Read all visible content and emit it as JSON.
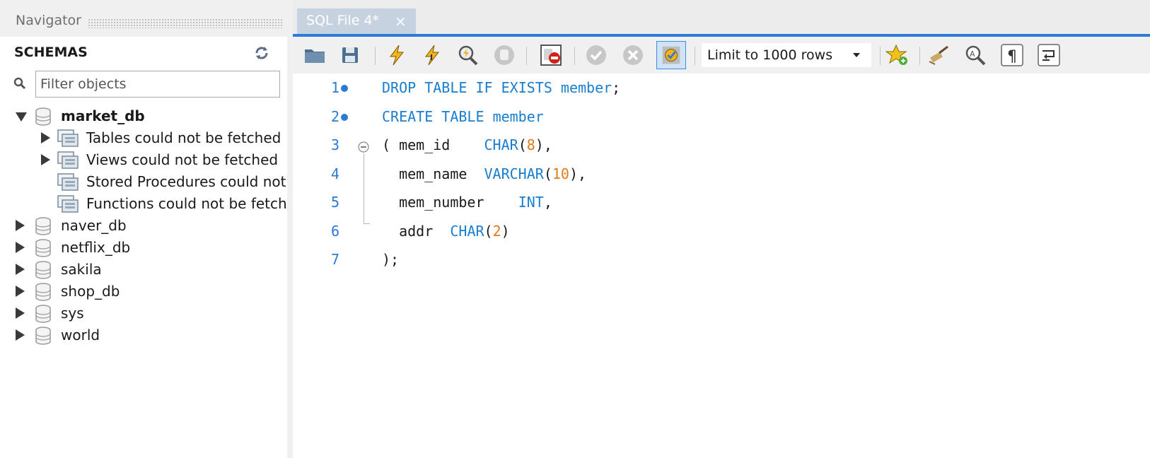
{
  "navigator": {
    "title": "Navigator",
    "schemas_label": "SCHEMAS",
    "filter_placeholder": "Filter objects",
    "tree": [
      {
        "label": "market_db",
        "expanded": true,
        "bold": true,
        "children": [
          {
            "label": "Tables could not be fetched",
            "has_arrow": true
          },
          {
            "label": "Views could not be fetched",
            "has_arrow": true
          },
          {
            "label": "Stored Procedures could not be fetched",
            "has_arrow": false
          },
          {
            "label": "Functions could not be fetched",
            "has_arrow": false
          }
        ]
      },
      {
        "label": "naver_db"
      },
      {
        "label": "netflix_db"
      },
      {
        "label": "sakila"
      },
      {
        "label": "shop_db"
      },
      {
        "label": "sys"
      },
      {
        "label": "world"
      }
    ]
  },
  "editor": {
    "tab_label": "SQL File 4*",
    "tab_close": "×",
    "limit_label": "Limit to 1000 rows",
    "code_lines": [
      {
        "num": "1",
        "marker": true,
        "text": "DROP TABLE IF EXISTS member;"
      },
      {
        "num": "2",
        "marker": true,
        "text": "CREATE TABLE member"
      },
      {
        "num": "3",
        "marker": false,
        "text": "( mem_id    CHAR(8),"
      },
      {
        "num": "4",
        "marker": false,
        "text": "  mem_name  VARCHAR(10),"
      },
      {
        "num": "5",
        "marker": false,
        "text": "  mem_number    INT,"
      },
      {
        "num": "6",
        "marker": false,
        "text": "  addr  CHAR(2)"
      },
      {
        "num": "7",
        "marker": false,
        "text": ");"
      }
    ]
  },
  "toolbar_icons": [
    "open-file-icon",
    "save-icon",
    "execute-icon",
    "execute-current-icon",
    "explain-icon",
    "stop-icon",
    "toggle-error-icon",
    "commit-icon",
    "rollback-icon",
    "autocommit-icon",
    "limit-rows-select",
    "bookmark-icon",
    "beautify-icon",
    "find-icon",
    "invisible-chars-icon",
    "wrap-icon"
  ],
  "colors": {
    "accent": "#2a7bd8",
    "keyword": "#1a7ed0",
    "number": "#e07b1a",
    "tab": "#c6d2e0"
  }
}
